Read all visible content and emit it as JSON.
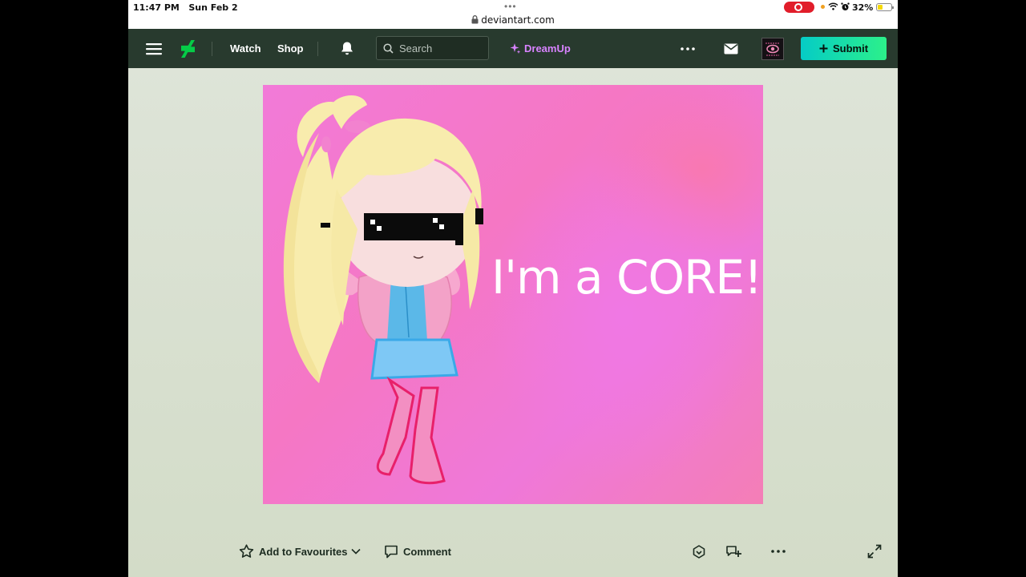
{
  "status_bar": {
    "time": "11:47 PM",
    "date": "Sun Feb 2",
    "url": "deviantart.com",
    "battery_percent": "32%",
    "battery_level": 0.32
  },
  "nav": {
    "menu_icon": "hamburger-icon",
    "logo_icon": "deviantart-logo",
    "watch_label": "Watch",
    "shop_label": "Shop",
    "notifications_icon": "bell-icon",
    "search_placeholder": "Search",
    "dreamup_label": "DreamUp",
    "more_icon": "ellipsis-icon",
    "mail_icon": "envelope-icon",
    "submit_label": "Submit"
  },
  "artwork": {
    "caption_text": "I'm a CORE!"
  },
  "actions": {
    "favourite_label": "Add to Favourites",
    "comment_label": "Comment"
  },
  "colors": {
    "nav_bg": "#283a2e",
    "accent_green": "#05cc47",
    "dreamup_purple": "#d883ff",
    "submit_gradient_start": "#05ccc6",
    "submit_gradient_end": "#2cf08a",
    "page_bg": "#dfe5da"
  }
}
